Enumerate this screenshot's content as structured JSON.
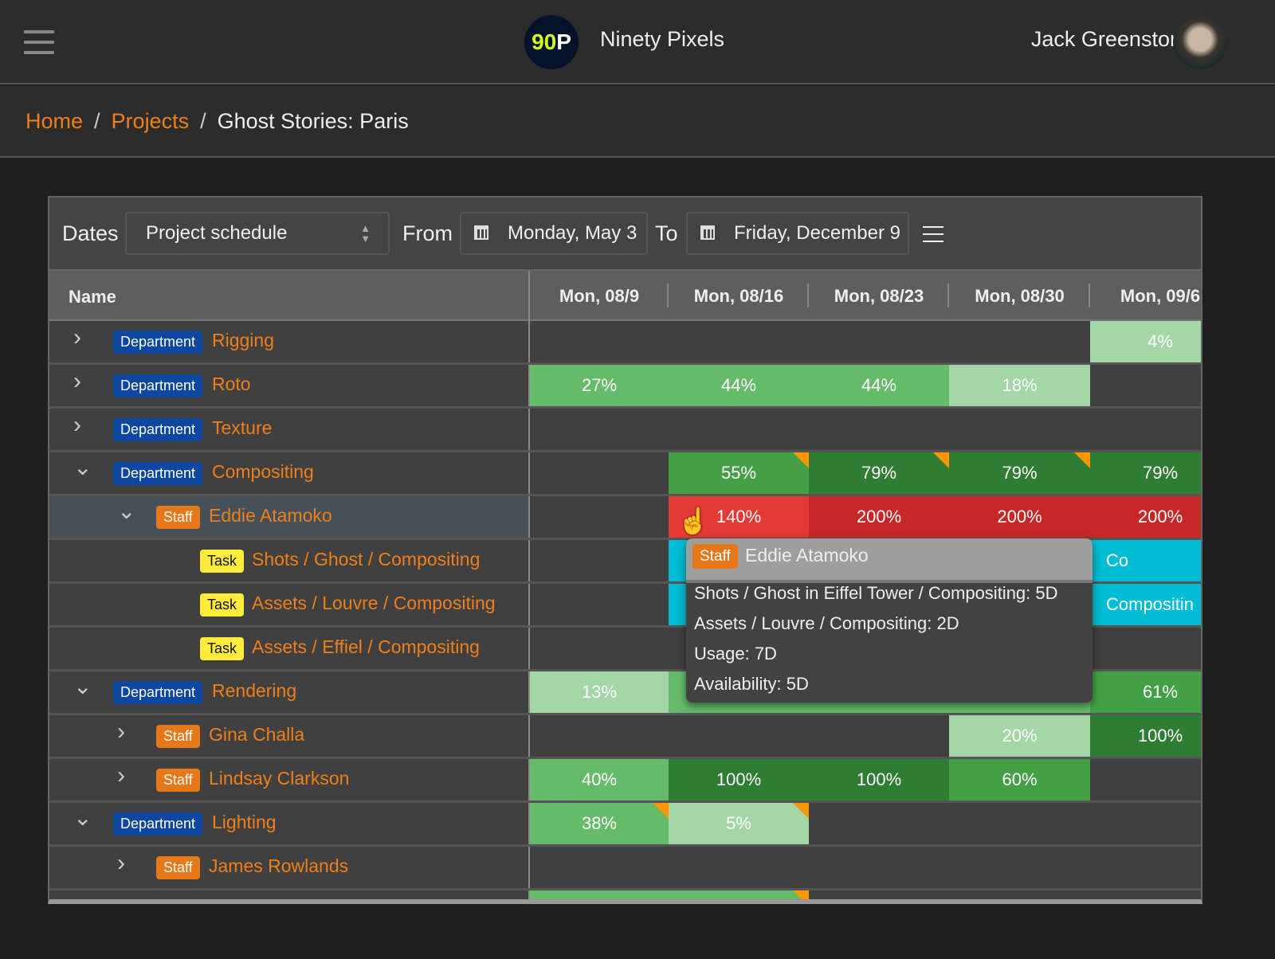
{
  "header": {
    "brand_logo": "90P",
    "brand_name": "Ninety Pixels",
    "user_name": "Jack Greenstone"
  },
  "breadcrumb": {
    "home": "Home",
    "projects": "Projects",
    "current": "Ghost Stories: Paris",
    "separator": "/"
  },
  "toolbar": {
    "dates_label": "Dates",
    "dates_select": "Project schedule",
    "from_label": "From",
    "from_date": "Monday, May 3",
    "to_label": "To",
    "to_date": "Friday, December 9"
  },
  "table": {
    "name_header": "Name",
    "columns": [
      "Mon, 08/9",
      "Mon, 08/16",
      "Mon, 08/23",
      "Mon, 08/30",
      "Mon, 09/6"
    ]
  },
  "colors": {
    "accent": "#ef7f1a",
    "department": "#0d47a1",
    "staff": "#e67817",
    "task": "#ffeb3b",
    "light_green": "#a5d6a7",
    "mid_green": "#66bb6a",
    "green": "#43a047",
    "dark_green": "#2e7d32",
    "red": "#e53935",
    "dark_red": "#c62828",
    "cyan": "#00bcd4",
    "overbook_flag": "#ff9800"
  },
  "rows": [
    {
      "type": "Department",
      "name": "Rigging",
      "expanded": false,
      "level": 0
    },
    {
      "type": "Department",
      "name": "Roto",
      "expanded": false,
      "level": 0
    },
    {
      "type": "Department",
      "name": "Texture",
      "expanded": false,
      "level": 0
    },
    {
      "type": "Department",
      "name": "Compositing",
      "expanded": true,
      "level": 0
    },
    {
      "type": "Staff",
      "name": "Eddie Atamoko",
      "expanded": true,
      "level": 1,
      "selected": true
    },
    {
      "type": "Task",
      "name": "Shots / Ghost / Compositing",
      "level": 2
    },
    {
      "type": "Task",
      "name": "Assets / Louvre / Compositing",
      "level": 2
    },
    {
      "type": "Task",
      "name": "Assets / Effiel / Compositing",
      "level": 2
    },
    {
      "type": "Department",
      "name": "Rendering",
      "expanded": true,
      "level": 0
    },
    {
      "type": "Staff",
      "name": "Gina Challa",
      "expanded": false,
      "level": 1
    },
    {
      "type": "Staff",
      "name": "Lindsay Clarkson",
      "expanded": false,
      "level": 1
    },
    {
      "type": "Department",
      "name": "Lighting",
      "expanded": true,
      "level": 0
    },
    {
      "type": "Staff",
      "name": "James Rowlands",
      "expanded": false,
      "level": 1
    },
    {
      "type": "Staff",
      "name": "",
      "expanded": false,
      "level": 1
    }
  ],
  "cells": [
    [
      {
        "col": 4,
        "span": 1,
        "text": "4%",
        "color": "light_green"
      }
    ],
    [
      {
        "col": 0,
        "span": 1,
        "text": "27%",
        "color": "mid_green"
      },
      {
        "col": 1,
        "span": 1,
        "text": "44%",
        "color": "mid_green"
      },
      {
        "col": 2,
        "span": 1,
        "text": "44%",
        "color": "mid_green"
      },
      {
        "col": 3,
        "span": 1,
        "text": "18%",
        "color": "light_green"
      }
    ],
    [],
    [
      {
        "col": 1,
        "span": 1,
        "text": "55%",
        "color": "green",
        "flag": true
      },
      {
        "col": 2,
        "span": 1,
        "text": "79%",
        "color": "dark_green",
        "flag": true
      },
      {
        "col": 3,
        "span": 1,
        "text": "79%",
        "color": "dark_green",
        "flag": true
      },
      {
        "col": 4,
        "span": 1,
        "text": "79%",
        "color": "dark_green"
      }
    ],
    [
      {
        "col": 1,
        "span": 1,
        "text": "140%",
        "color": "red"
      },
      {
        "col": 2,
        "span": 1,
        "text": "200%",
        "color": "dark_red"
      },
      {
        "col": 3,
        "span": 1,
        "text": "200%",
        "color": "dark_red"
      },
      {
        "col": 4,
        "span": 1,
        "text": "200%",
        "color": "dark_red"
      }
    ],
    [
      {
        "col": 1,
        "span": 4,
        "text": "Co",
        "color": "cyan",
        "align": "right"
      }
    ],
    [
      {
        "col": 1,
        "span": 4,
        "text": "Compositin",
        "color": "cyan",
        "align": "right"
      }
    ],
    [],
    [
      {
        "col": 0,
        "span": 1,
        "text": "13%",
        "color": "light_green"
      },
      {
        "col": 1,
        "span": 3,
        "text": "",
        "color": "mid_green"
      },
      {
        "col": 4,
        "span": 1,
        "text": "61%",
        "color": "green"
      }
    ],
    [
      {
        "col": 3,
        "span": 1,
        "text": "20%",
        "color": "light_green"
      },
      {
        "col": 4,
        "span": 1,
        "text": "100%",
        "color": "dark_green"
      }
    ],
    [
      {
        "col": 0,
        "span": 1,
        "text": "40%",
        "color": "mid_green"
      },
      {
        "col": 1,
        "span": 1,
        "text": "100%",
        "color": "dark_green"
      },
      {
        "col": 2,
        "span": 1,
        "text": "100%",
        "color": "dark_green"
      },
      {
        "col": 3,
        "span": 1,
        "text": "60%",
        "color": "green"
      }
    ],
    [
      {
        "col": 0,
        "span": 1,
        "text": "38%",
        "color": "mid_green",
        "flag": true
      },
      {
        "col": 1,
        "span": 1,
        "text": "5%",
        "color": "light_green",
        "flag": true
      }
    ],
    [],
    [
      {
        "col": 0,
        "span": 2,
        "text": "",
        "color": "mid_green",
        "flag": true
      }
    ]
  ],
  "tooltip": {
    "badge": "Staff",
    "name": "Eddie Atamoko",
    "lines": [
      "Shots / Ghost in Eiffel Tower / Compositing: 5D",
      "Assets / Louvre / Compositing: 2D",
      "Usage: 7D",
      "Availability: 5D"
    ]
  }
}
